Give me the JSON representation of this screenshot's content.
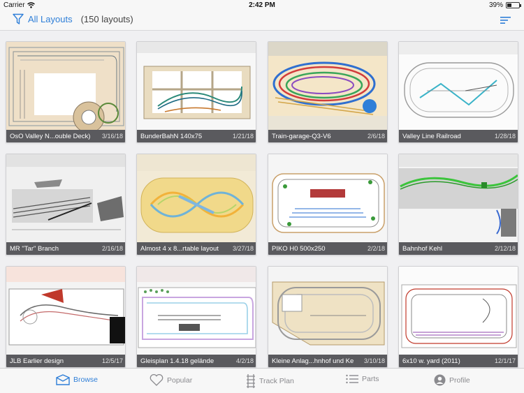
{
  "status": {
    "carrier": "Carrier",
    "time": "2:42 PM",
    "battery": "39%",
    "battery_level": 0.39
  },
  "nav": {
    "title": "All Layouts",
    "count": "(150 layouts)"
  },
  "accent": "#2f7fd8",
  "layouts": [
    {
      "name": "OsO Valley N...ouble Deck)",
      "date": "3/16/18"
    },
    {
      "name": "BunderBahN 140x75",
      "date": "1/21/18"
    },
    {
      "name": "Train-garage-Q3-V6",
      "date": "2/6/18"
    },
    {
      "name": "Valley Line Railroad",
      "date": "1/28/18"
    },
    {
      "name": "MR \"Tar\" Branch",
      "date": "2/16/18"
    },
    {
      "name": "Almost 4 x 8...rtable layout",
      "date": "3/27/18"
    },
    {
      "name": "PIKO H0 500x250",
      "date": "2/2/18"
    },
    {
      "name": "Bahnhof Kehl",
      "date": "2/12/18"
    },
    {
      "name": "JLB Earlier design",
      "date": "12/5/17"
    },
    {
      "name": "Gleisplan 1.4.18 gelände",
      "date": "4/2/18"
    },
    {
      "name": "Kleine Anlag...hnhof und Ke",
      "date": "3/10/18"
    },
    {
      "name": "6x10 w. yard (2011)",
      "date": "12/1/17"
    }
  ],
  "tabs": [
    {
      "label": "Browse",
      "icon": "browse-icon",
      "active": true
    },
    {
      "label": "Popular",
      "icon": "heart-icon",
      "active": false
    },
    {
      "label": "Track Plan",
      "icon": "track-plan-icon",
      "active": false
    },
    {
      "label": "Parts",
      "icon": "parts-list-icon",
      "active": false
    },
    {
      "label": "Profile",
      "icon": "profile-icon",
      "active": false
    }
  ]
}
